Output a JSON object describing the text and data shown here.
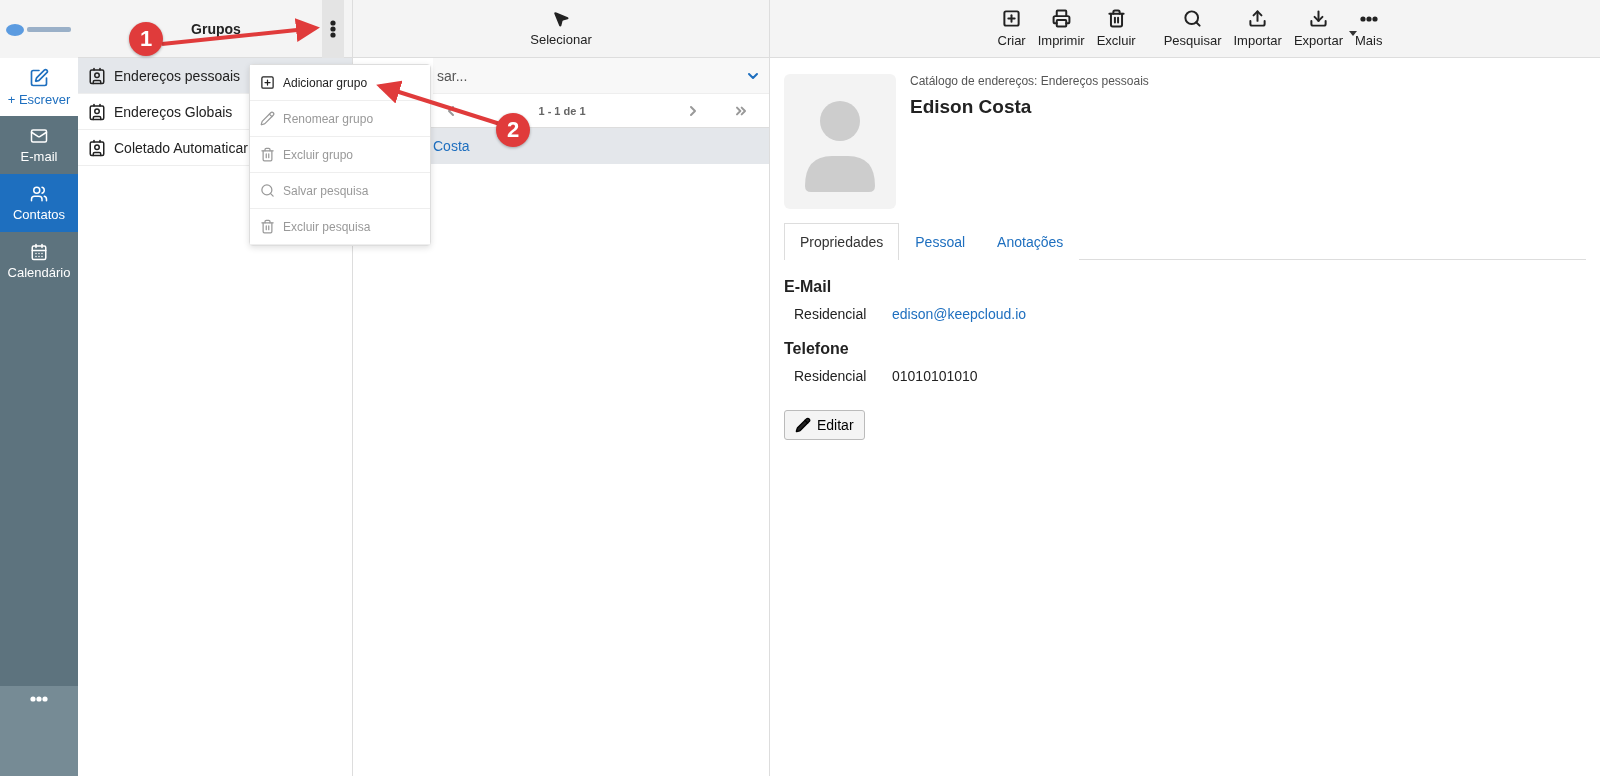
{
  "nav": {
    "compose": "+ Escrever",
    "items": [
      {
        "kind": "mail",
        "label": "E-mail",
        "selected": false
      },
      {
        "kind": "contacts",
        "label": "Contatos",
        "selected": true
      },
      {
        "kind": "calendar",
        "label": "Calendário",
        "selected": false
      }
    ]
  },
  "groups": {
    "title": "Grupos",
    "items": [
      {
        "label": "Endereços pessoais",
        "selected": true
      },
      {
        "label": "Endereços Globais",
        "selected": false
      },
      {
        "label": "Coletado Automaticar",
        "selected": false
      }
    ]
  },
  "menu": [
    {
      "kind": "add",
      "label": "Adicionar grupo",
      "disabled": false
    },
    {
      "kind": "rename",
      "label": "Renomear grupo",
      "disabled": true
    },
    {
      "kind": "delete",
      "label": "Excluir grupo",
      "disabled": true
    },
    {
      "kind": "search",
      "label": "Salvar pesquisa",
      "disabled": true
    },
    {
      "kind": "delete",
      "label": "Excluir pesquisa",
      "disabled": true
    }
  ],
  "list": {
    "select": "Selecionar",
    "search": {
      "placeholder": "sar..."
    },
    "pagination": "1 - 1 de 1",
    "rows": [
      {
        "name": "Costa",
        "selected": true
      }
    ]
  },
  "toolbar": [
    {
      "kind": "create",
      "label": "Criar"
    },
    {
      "kind": "print",
      "label": "Imprimir"
    },
    {
      "kind": "delete",
      "label": "Excluir"
    },
    {
      "kind": "search",
      "label": "Pesquisar"
    },
    {
      "kind": "import",
      "label": "Importar"
    },
    {
      "kind": "export",
      "label": "Exportar"
    },
    {
      "kind": "more",
      "label": "Mais"
    }
  ],
  "contact": {
    "catalog": "Catálogo de endereços: Endereços pessoais",
    "name": "Edison Costa",
    "tabs": [
      {
        "label": "Propriedades",
        "selected": true
      },
      {
        "label": "Pessoal",
        "selected": false
      },
      {
        "label": "Anotações",
        "selected": false
      }
    ],
    "sections": [
      {
        "title": "E-Mail",
        "rows": [
          {
            "label": "Residencial",
            "value": "edison@keepcloud.io",
            "kind": "link"
          }
        ]
      },
      {
        "title": "Telefone",
        "rows": [
          {
            "label": "Residencial",
            "value": "01010101010",
            "kind": "text"
          }
        ]
      }
    ],
    "edit": "Editar"
  },
  "annotations": [
    {
      "label": "1"
    },
    {
      "label": "2"
    }
  ]
}
